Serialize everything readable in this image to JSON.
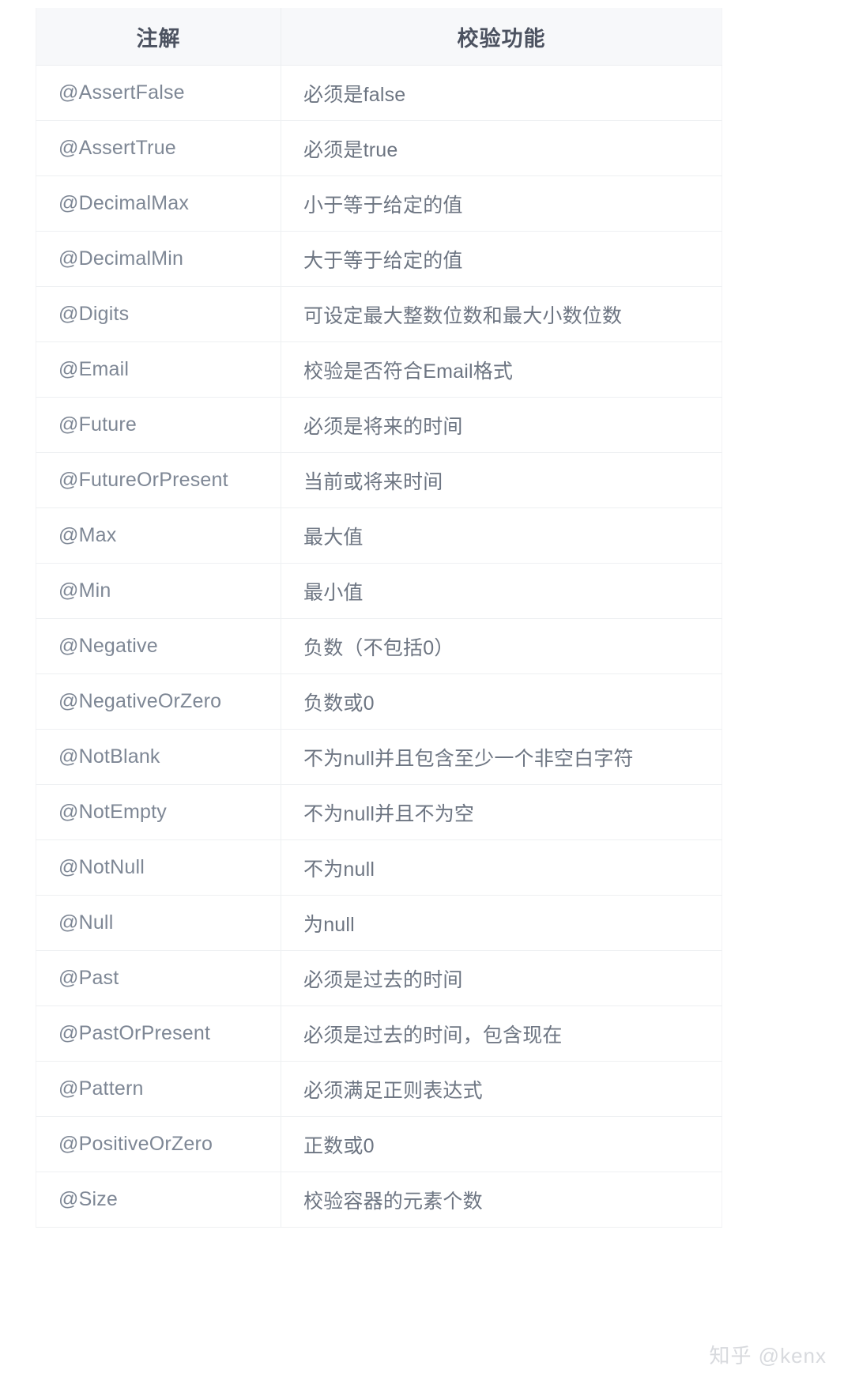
{
  "table": {
    "columns": [
      {
        "key": "annotation",
        "label": "注解"
      },
      {
        "key": "description",
        "label": "校验功能"
      }
    ],
    "rows": [
      {
        "annotation": "@AssertFalse",
        "description": "必须是false"
      },
      {
        "annotation": "@AssertTrue",
        "description": "必须是true"
      },
      {
        "annotation": "@DecimalMax",
        "description": "小于等于给定的值"
      },
      {
        "annotation": "@DecimalMin",
        "description": "大于等于给定的值"
      },
      {
        "annotation": "@Digits",
        "description": "可设定最大整数位数和最大小数位数"
      },
      {
        "annotation": "@Email",
        "description": "校验是否符合Email格式"
      },
      {
        "annotation": "@Future",
        "description": "必须是将来的时间"
      },
      {
        "annotation": "@FutureOrPresent",
        "description": "当前或将来时间"
      },
      {
        "annotation": "@Max",
        "description": "最大值"
      },
      {
        "annotation": "@Min",
        "description": "最小值"
      },
      {
        "annotation": "@Negative",
        "description": "负数（不包括0）"
      },
      {
        "annotation": "@NegativeOrZero",
        "description": "负数或0"
      },
      {
        "annotation": "@NotBlank",
        "description": "不为null并且包含至少一个非空白字符"
      },
      {
        "annotation": "@NotEmpty",
        "description": "不为null并且不为空"
      },
      {
        "annotation": "@NotNull",
        "description": "不为null"
      },
      {
        "annotation": "@Null",
        "description": "为null"
      },
      {
        "annotation": "@Past",
        "description": "必须是过去的时间"
      },
      {
        "annotation": "@PastOrPresent",
        "description": "必须是过去的时间，包含现在"
      },
      {
        "annotation": "@Pattern",
        "description": "必须满足正则表达式"
      },
      {
        "annotation": "@PositiveOrZero",
        "description": "正数或0"
      },
      {
        "annotation": "@Size",
        "description": "校验容器的元素个数"
      }
    ]
  },
  "watermark": {
    "text": "知乎 @kenx"
  },
  "colors": {
    "header_background": "#f7f8fa",
    "header_text": "#4c5260",
    "annotation_text": "#7e8795",
    "description_text": "#6d7582",
    "row_border": "#eef0f2",
    "page_background": "#ffffff",
    "watermark_text": "#d8dade"
  }
}
